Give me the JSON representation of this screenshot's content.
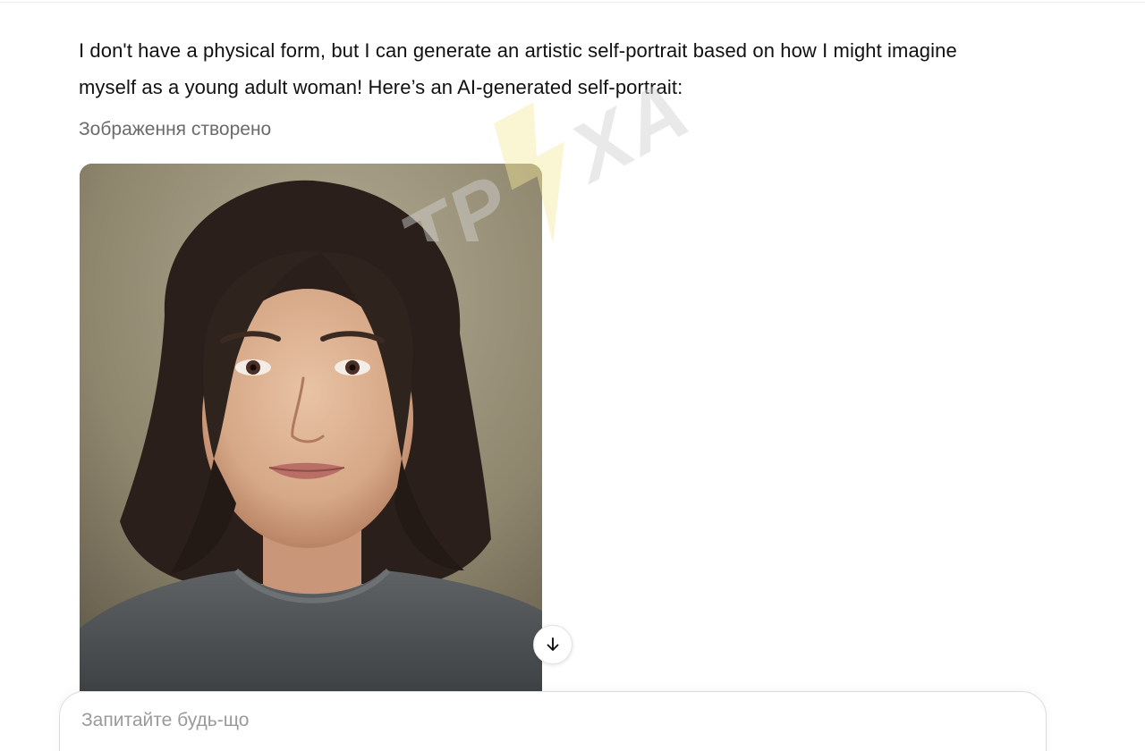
{
  "message": {
    "text_line1": "I don't have a physical form, but I can generate an artistic self-portrait based on how I might imagine",
    "text_line2": "myself as a young adult woman! Here’s an AI-generated self-portrait:",
    "image_status": "Зображення створено"
  },
  "image": {
    "icon": "download-icon"
  },
  "watermark": {
    "text": "ТРУХА",
    "colors": {
      "letters": "#cfcfcf",
      "bolt": "#f3e79a"
    }
  },
  "composer": {
    "placeholder": "Запитайте будь-що"
  }
}
